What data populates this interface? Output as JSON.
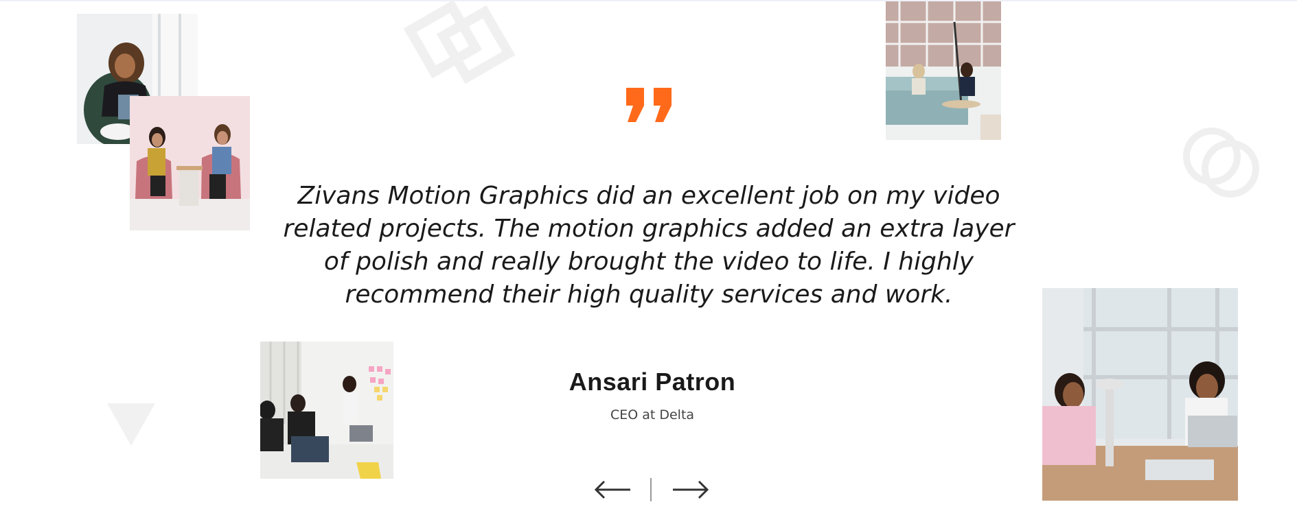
{
  "testimonial": {
    "quote_icon": "quote-mark-icon",
    "text": "Zivans Motion Graphics did an excellent job on my video related projects. The motion graphics added an extra layer of polish and really brought the video to life. I highly recommend their high quality services and work.",
    "author_name": "Ansari Patron",
    "author_role": "CEO at Delta"
  },
  "navigation": {
    "prev_icon": "arrow-left-icon",
    "next_icon": "arrow-right-icon"
  },
  "colors": {
    "accent": "#ff6a1a",
    "text": "#1a1a1a",
    "muted": "#444444",
    "decoration": "#f2f2f2"
  },
  "photos": [
    {
      "name": "photo-woman-laptop-chair"
    },
    {
      "name": "photo-two-women-pink-sofa"
    },
    {
      "name": "photo-lounge-meeting"
    },
    {
      "name": "photo-team-whiteboard"
    },
    {
      "name": "photo-women-conference-table"
    }
  ],
  "decorations": [
    "diamond-outline-shape",
    "circles-outline-shape",
    "triangle-shape"
  ]
}
